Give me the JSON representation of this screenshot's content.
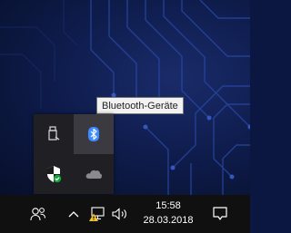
{
  "tooltip": {
    "text": "Bluetooth-Geräte"
  },
  "tray_flyout": {
    "icons": [
      {
        "name": "usb-drive-icon",
        "selected": false
      },
      {
        "name": "bluetooth-icon",
        "selected": true
      },
      {
        "name": "security-shield-icon",
        "selected": false
      },
      {
        "name": "onedrive-cloud-icon",
        "selected": false
      }
    ]
  },
  "taskbar": {
    "icons": [
      "people-icon",
      "chevron-up-icon",
      "network-warning-icon",
      "volume-icon",
      "action-center-icon"
    ],
    "clock": {
      "time": "15:58",
      "date": "28.03.2018"
    }
  },
  "colors": {
    "accent": "#3c8cff",
    "taskbar": "#101010",
    "flyout": "#1f1f24",
    "tooltip_bg": "#f2f2f2"
  }
}
